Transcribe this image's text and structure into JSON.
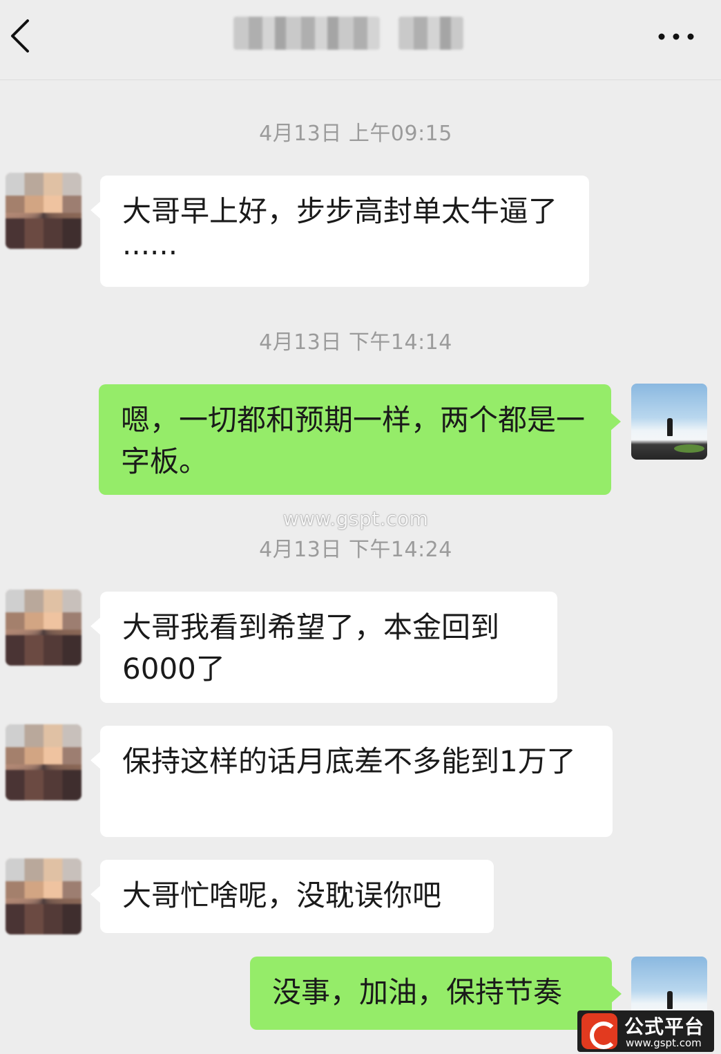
{
  "header": {
    "back_icon": "chevron-left-icon",
    "title_redacted": true,
    "more_icon": "more-horizontal-icon"
  },
  "colors": {
    "background": "#ededed",
    "incoming_bubble": "#ffffff",
    "outgoing_bubble": "#95ec69",
    "timestamp_text": "#9b9b9b"
  },
  "messages": [
    {
      "timestamp": "4月13日 上午09:15"
    },
    {
      "direction": "incoming",
      "text": "大哥早上好，步步高封单太牛逼了······"
    },
    {
      "timestamp": "4月13日 下午14:14"
    },
    {
      "direction": "outgoing",
      "text": "嗯，一切都和预期一样，两个都是一字板。"
    },
    {
      "timestamp": "4月13日 下午14:24"
    },
    {
      "direction": "incoming",
      "text": "大哥我看到希望了，本金回到6000了"
    },
    {
      "direction": "incoming",
      "text": "保持这样的话月底差不多能到1万了"
    },
    {
      "direction": "incoming",
      "text": "大哥忙啥呢，没耽误你吧"
    },
    {
      "direction": "outgoing",
      "text": "没事，加油，保持节奏"
    }
  ],
  "watermark": {
    "center_url": "www.gspt.com",
    "badge_title": "公式平台",
    "badge_url": "www.gspt.com"
  }
}
